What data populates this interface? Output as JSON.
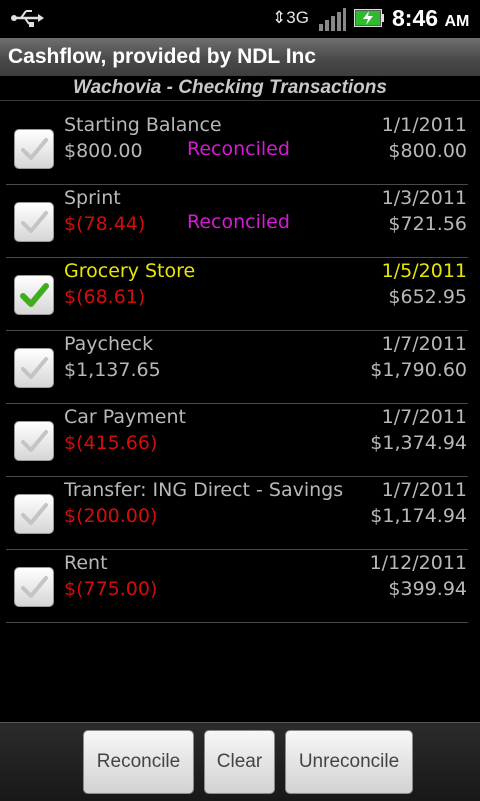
{
  "status_bar": {
    "network": "3G",
    "time": "8:46",
    "ampm": "AM",
    "icons": [
      "usb-icon",
      "data-arrows-icon",
      "signal-icon",
      "battery-charging-icon"
    ]
  },
  "app": {
    "title": "Cashflow, provided by NDL Inc",
    "subtitle": "Wachovia - Checking Transactions"
  },
  "colors": {
    "reconciled": "#d61ad6",
    "negative": "#d30c0c",
    "selected": "#e6e600",
    "check_green": "#3fae1d"
  },
  "transactions": [
    {
      "name": "Starting Balance",
      "amount": "$800.00",
      "negative": false,
      "status": "Reconciled",
      "date": "1/1/2011",
      "balance": "$800.00",
      "checked": false,
      "selected": false
    },
    {
      "name": "Sprint",
      "amount": "$(78.44)",
      "negative": true,
      "status": "Reconciled",
      "date": "1/3/2011",
      "balance": "$721.56",
      "checked": false,
      "selected": false
    },
    {
      "name": "Grocery Store",
      "amount": "$(68.61)",
      "negative": true,
      "status": "",
      "date": "1/5/2011",
      "balance": "$652.95",
      "checked": true,
      "selected": true
    },
    {
      "name": "Paycheck",
      "amount": "$1,137.65",
      "negative": false,
      "status": "",
      "date": "1/7/2011",
      "balance": "$1,790.60",
      "checked": false,
      "selected": false
    },
    {
      "name": "Car Payment",
      "amount": "$(415.66)",
      "negative": true,
      "status": "",
      "date": "1/7/2011",
      "balance": "$1,374.94",
      "checked": false,
      "selected": false
    },
    {
      "name": "Transfer: ING Direct - Savings",
      "amount": "$(200.00)",
      "negative": true,
      "status": "",
      "date": "1/7/2011",
      "balance": "$1,174.94",
      "checked": false,
      "selected": false
    },
    {
      "name": "Rent",
      "amount": "$(775.00)",
      "negative": true,
      "status": "",
      "date": "1/12/2011",
      "balance": "$399.94",
      "checked": false,
      "selected": false
    }
  ],
  "buttons": {
    "reconcile": "Reconcile",
    "clear": "Clear",
    "unreconcile": "Unreconcile"
  }
}
